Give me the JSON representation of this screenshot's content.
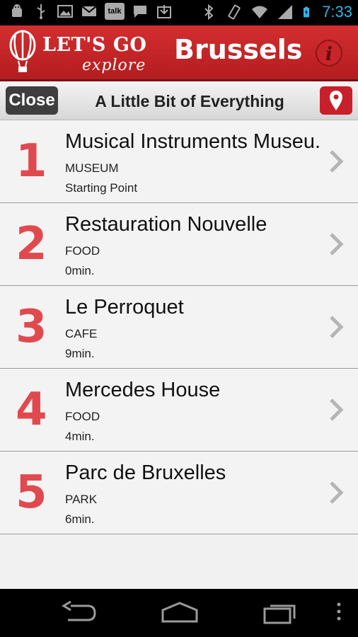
{
  "status_bar": {
    "time": "7:33",
    "left_icons": [
      "android-debug-icon",
      "usb-icon",
      "image-icon",
      "gmail-icon",
      "talk-icon",
      "chat-icon",
      "download-icon"
    ],
    "right_icons": [
      "bluetooth-icon",
      "vibrate-icon",
      "wifi-icon",
      "signal-icon",
      "battery-icon"
    ],
    "talk_label": "talk"
  },
  "header": {
    "logo_line1": "LET'S GO",
    "logo_line2": "explore",
    "city": "Brussels",
    "info_label": "i",
    "brand_color": "#c8252a"
  },
  "toolbar": {
    "close_label": "Close",
    "title": "A Little Bit of Everything"
  },
  "stops": [
    {
      "number": "1",
      "name": "Musical Instruments Museu..",
      "category": "MUSEUM",
      "time": "Starting Point"
    },
    {
      "number": "2",
      "name": "Restauration Nouvelle",
      "category": "FOOD",
      "time": "0min."
    },
    {
      "number": "3",
      "name": "Le Perroquet",
      "category": "CAFE",
      "time": "9min."
    },
    {
      "number": "4",
      "name": "Mercedes House",
      "category": "FOOD",
      "time": "4min."
    },
    {
      "number": "5",
      "name": "Parc de Bruxelles",
      "category": "PARK",
      "time": "6min."
    }
  ],
  "nav_bar": {
    "buttons": [
      "back-icon",
      "home-icon",
      "recent-apps-icon",
      "menu-icon"
    ]
  }
}
